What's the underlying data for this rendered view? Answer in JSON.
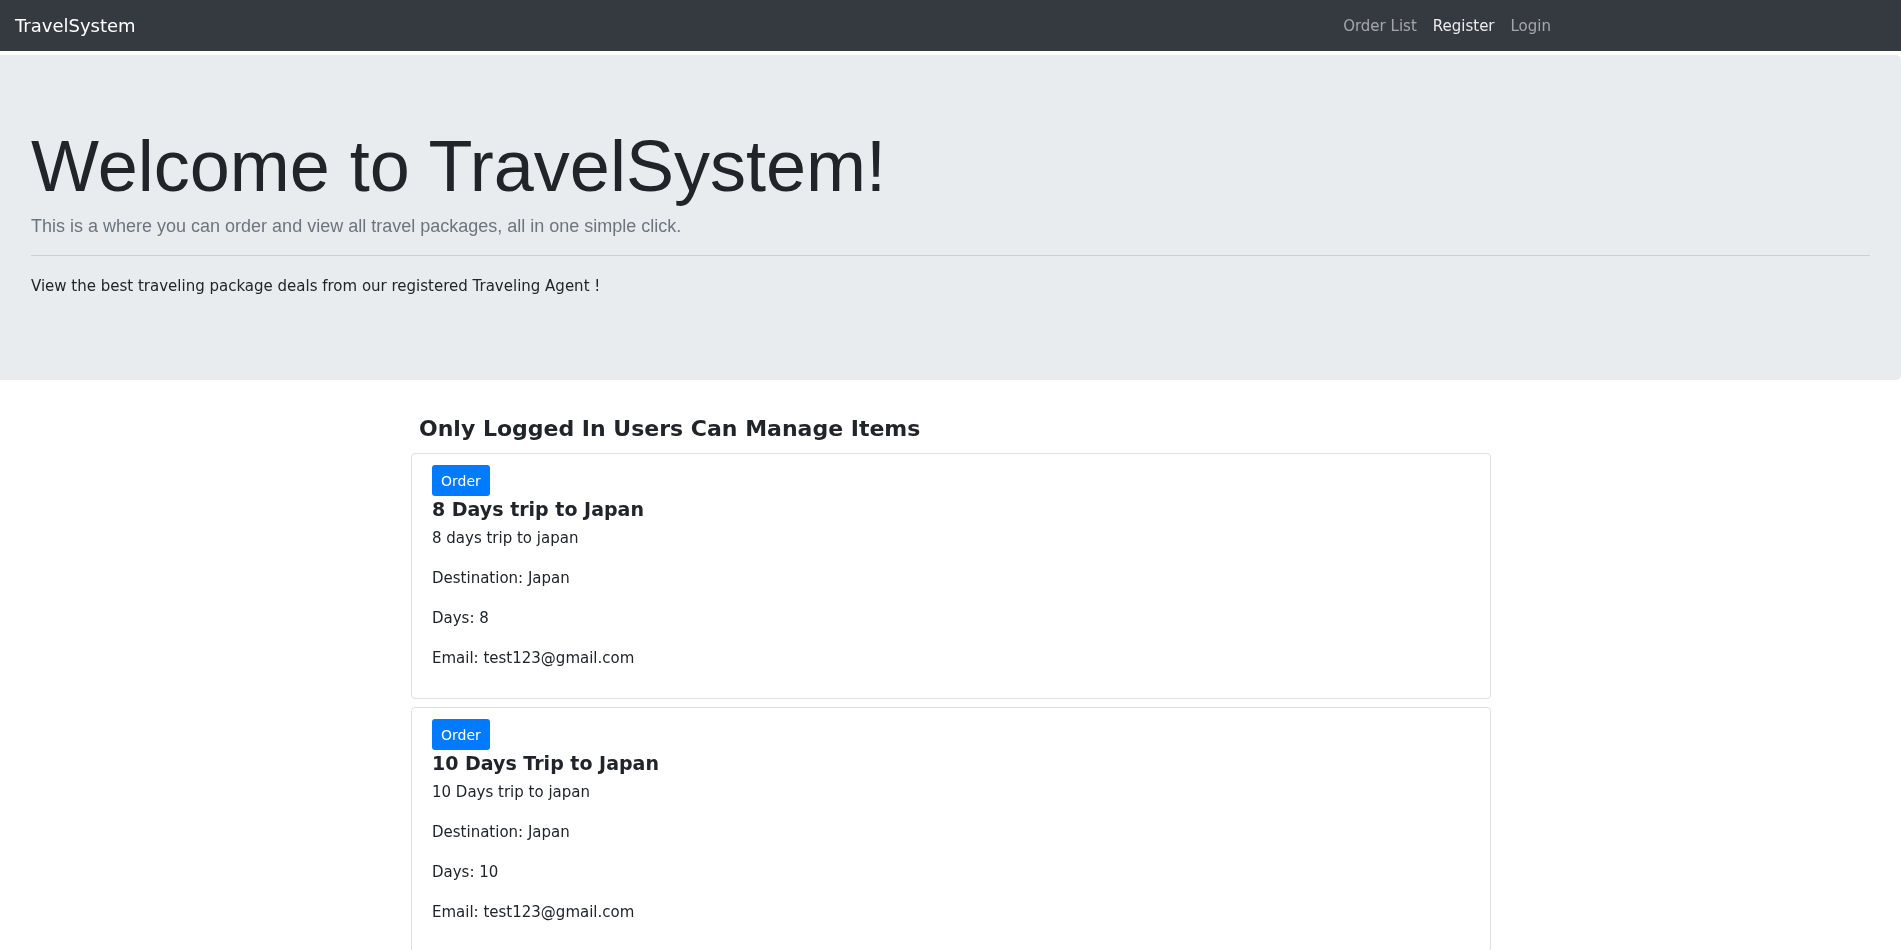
{
  "navbar": {
    "brand": "TravelSystem",
    "links": [
      {
        "label": "Order List",
        "selected": false
      },
      {
        "label": "Register",
        "selected": true
      },
      {
        "label": "Login",
        "selected": false
      }
    ]
  },
  "hero": {
    "title": "Welcome to TravelSystem!",
    "lead": "This is a where you can order and view all travel packages, all in one simple click.",
    "text": "View the best traveling package deals from our registered Traveling Agent !"
  },
  "section_title": "Only Logged In Users Can Manage Items",
  "packages": [
    {
      "button": "Order",
      "title": "8 Days trip to Japan",
      "description": "8 days trip to japan",
      "destination": "Destination: Japan",
      "days": "Days: 8",
      "email": "Email: test123@gmail.com"
    },
    {
      "button": "Order",
      "title": "10 Days Trip to Japan",
      "description": "10 Days trip to japan",
      "destination": "Destination: Japan",
      "days": "Days: 10",
      "email": "Email: test123@gmail.com"
    }
  ]
}
